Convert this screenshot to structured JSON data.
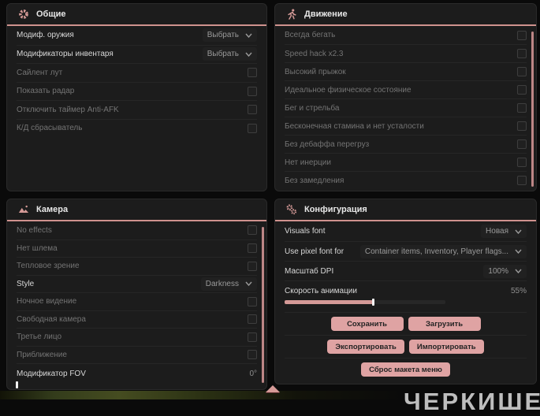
{
  "accent_color": "#cf928e",
  "button_color": "#dfa3a3",
  "panels": {
    "general": {
      "title": "Общие",
      "rows": [
        {
          "label": "Модиф. оружия",
          "control": "dropdown",
          "value": "Выбрать"
        },
        {
          "label": "Модификаторы инвентаря",
          "control": "dropdown",
          "value": "Выбрать"
        },
        {
          "label": "Сайлент лут",
          "control": "checkbox",
          "checked": false
        },
        {
          "label": "Показать радар",
          "control": "checkbox",
          "checked": false
        },
        {
          "label": "Отключить таймер Anti-AFK",
          "control": "checkbox",
          "checked": false
        },
        {
          "label": "К/Д сбрасыватель",
          "control": "checkbox",
          "checked": false
        }
      ]
    },
    "movement": {
      "title": "Движение",
      "rows": [
        {
          "label": "Всегда бегать",
          "control": "checkbox",
          "checked": false
        },
        {
          "label": "Speed hack x2.3",
          "control": "checkbox",
          "checked": false
        },
        {
          "label": "Высокий прыжок",
          "control": "checkbox",
          "checked": false
        },
        {
          "label": "Идеальное физическое состояние",
          "control": "checkbox",
          "checked": false
        },
        {
          "label": "Бег и стрельба",
          "control": "checkbox",
          "checked": false
        },
        {
          "label": "Бесконечная стамина и нет усталости",
          "control": "checkbox",
          "checked": false
        },
        {
          "label": "Без дебаффа перегруз",
          "control": "checkbox",
          "checked": false
        },
        {
          "label": "Нет инерции",
          "control": "checkbox",
          "checked": false
        },
        {
          "label": "Без замедления",
          "control": "checkbox",
          "checked": false
        }
      ]
    },
    "camera": {
      "title": "Камера",
      "rows": [
        {
          "label": "No effects",
          "control": "checkbox",
          "checked": false
        },
        {
          "label": "Нет шлема",
          "control": "checkbox",
          "checked": false
        },
        {
          "label": "Тепловое зрение",
          "control": "checkbox",
          "checked": false
        },
        {
          "label": "Style",
          "control": "dropdown",
          "value": "Darkness"
        },
        {
          "label": "Ночное видение",
          "control": "checkbox",
          "checked": false
        },
        {
          "label": "Свободная камера",
          "control": "checkbox",
          "checked": false
        },
        {
          "label": "Третье лицо",
          "control": "checkbox",
          "checked": false
        },
        {
          "label": "Приближение",
          "control": "checkbox",
          "checked": false
        },
        {
          "label": "Модификатор FOV",
          "control": "slider",
          "value": "0°",
          "percent": 0
        }
      ]
    },
    "config": {
      "title": "Конфигурация",
      "rows": [
        {
          "label": "Visuals font",
          "control": "dropdown",
          "value": "Новая"
        },
        {
          "label": "Use pixel font for",
          "control": "dropdown",
          "value": "Container items, Inventory, Player flags..."
        },
        {
          "label": "Масштаб DPI",
          "control": "dropdown",
          "value": "100%"
        },
        {
          "label": "Скорость анимации",
          "control": "slider",
          "value": "55%",
          "percent": 55
        }
      ],
      "buttons": {
        "save": "Сохранить",
        "load": "Загрузить",
        "export": "Экспортировать",
        "import": "Импортировать",
        "reset_layout": "Сброс макета меню"
      }
    }
  },
  "watermark": "ЧЕРКИШЕ"
}
